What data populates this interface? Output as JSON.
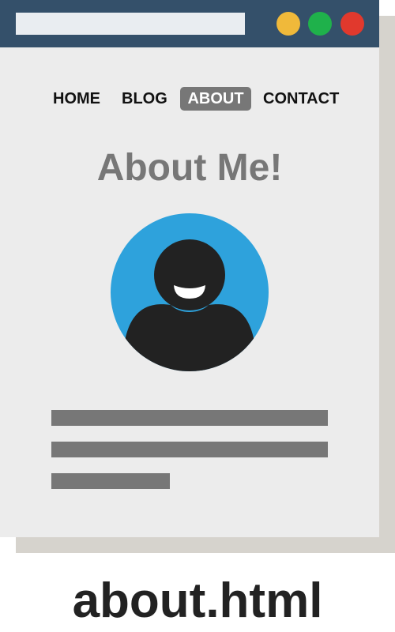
{
  "colors": {
    "titlebar": "#34506a",
    "window_background": "#ececec",
    "shadow": "#d6d3cd",
    "dot_minimize": "#f0b93a",
    "dot_maximize": "#1fb14b",
    "dot_close": "#e1392d",
    "active_nav_background": "#777777",
    "avatar_background": "#2ea2dc",
    "avatar_figure": "#222222"
  },
  "nav": {
    "items": [
      "HOME",
      "BLOG",
      "ABOUT",
      "CONTACT"
    ],
    "active": "ABOUT"
  },
  "page": {
    "heading": "About Me!"
  },
  "avatar": {
    "icon": "user-avatar-icon"
  },
  "file": {
    "name": "about.html"
  }
}
